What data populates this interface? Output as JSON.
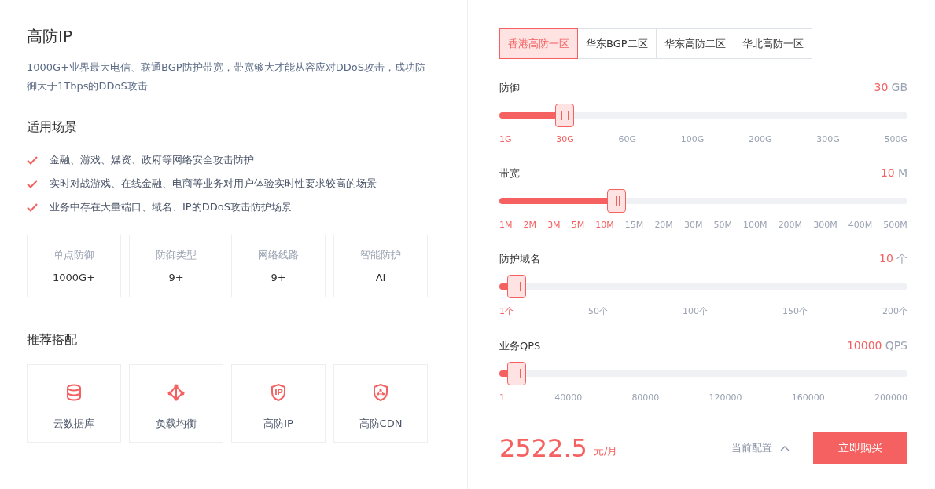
{
  "product": {
    "title": "高防IP",
    "description": "1000G+业界最大电信、联通BGP防护带宽，带宽够大才能从容应对DDoS攻击，成功防御大于1Tbps的DDoS攻击"
  },
  "scenarios": {
    "title": "适用场景",
    "items": [
      "金融、游戏、媒资、政府等网络安全攻击防护",
      "实时对战游戏、在线金融、电商等业务对用户体验实时性要求较高的场景",
      "业务中存在大量端口、域名、IP的DDoS攻击防护场景"
    ]
  },
  "stats": [
    {
      "label": "单点防御",
      "value": "1000G+"
    },
    {
      "label": "防御类型",
      "value": "9+"
    },
    {
      "label": "网络线路",
      "value": "9+"
    },
    {
      "label": "智能防护",
      "value": "AI"
    }
  ],
  "recommended": {
    "title": "推荐搭配",
    "items": [
      {
        "kind": "database",
        "label": "云数据库"
      },
      {
        "kind": "balancer",
        "label": "负载均衡"
      },
      {
        "kind": "ip-shield",
        "label": "高防IP"
      },
      {
        "kind": "cdn-shield",
        "label": "高防CDN"
      }
    ]
  },
  "regions": [
    {
      "label": "香港高防一区",
      "selected": true
    },
    {
      "label": "华东BGP二区",
      "selected": false
    },
    {
      "label": "华东高防二区",
      "selected": false
    },
    {
      "label": "华北高防一区",
      "selected": false
    }
  ],
  "sliders": [
    {
      "label": "防御",
      "value": "30",
      "unit": "GB",
      "level": 0.16,
      "ticks": [
        {
          "label": "1G",
          "active": true
        },
        {
          "label": "30G",
          "active": true
        },
        {
          "label": "60G",
          "active": false
        },
        {
          "label": "100G",
          "active": false
        },
        {
          "label": "200G",
          "active": false
        },
        {
          "label": "300G",
          "active": false
        },
        {
          "label": "500G",
          "active": false
        }
      ]
    },
    {
      "label": "带宽",
      "value": "10",
      "unit": "M",
      "level": 0.287,
      "ticks": [
        {
          "label": "1M",
          "active": true
        },
        {
          "label": "2M",
          "active": true
        },
        {
          "label": "3M",
          "active": true
        },
        {
          "label": "5M",
          "active": true
        },
        {
          "label": "10M",
          "active": true
        },
        {
          "label": "15M",
          "active": false
        },
        {
          "label": "20M",
          "active": false
        },
        {
          "label": "30M",
          "active": false
        },
        {
          "label": "50M",
          "active": false
        },
        {
          "label": "100M",
          "active": false
        },
        {
          "label": "200M",
          "active": false
        },
        {
          "label": "300M",
          "active": false
        },
        {
          "label": "400M",
          "active": false
        },
        {
          "label": "500M",
          "active": false
        }
      ]
    },
    {
      "label": "防护域名",
      "value": "10",
      "unit": "个",
      "level": 0.043,
      "ticks": [
        {
          "label": "1个",
          "active": true
        },
        {
          "label": "50个",
          "active": false
        },
        {
          "label": "100个",
          "active": false
        },
        {
          "label": "150个",
          "active": false
        },
        {
          "label": "200个",
          "active": false
        }
      ]
    },
    {
      "label": "业务QPS",
      "value": "10000",
      "unit": "QPS",
      "level": 0.043,
      "ticks": [
        {
          "label": "1",
          "active": true
        },
        {
          "label": "40000",
          "active": false
        },
        {
          "label": "80000",
          "active": false
        },
        {
          "label": "120000",
          "active": false
        },
        {
          "label": "160000",
          "active": false
        },
        {
          "label": "200000",
          "active": false
        }
      ]
    }
  ],
  "footer": {
    "price": "2522.5",
    "price_unit": "元/月",
    "config_toggle": "当前配置",
    "buy_button": "立即购买"
  }
}
